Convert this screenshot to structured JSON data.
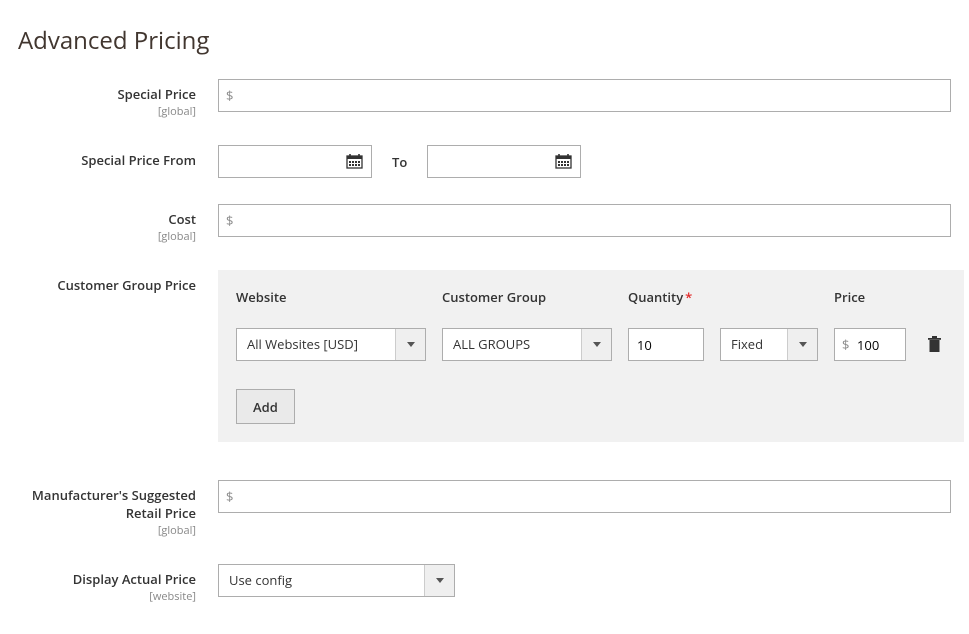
{
  "title": "Advanced Pricing",
  "scopes": {
    "global": "[global]",
    "website": "[website]"
  },
  "currency_symbol": "$",
  "specialPrice": {
    "label": "Special Price",
    "value": ""
  },
  "specialPriceFrom": {
    "label": "Special Price From",
    "from": "",
    "to_label": "To",
    "to": ""
  },
  "cost": {
    "label": "Cost",
    "value": ""
  },
  "groupPrice": {
    "label": "Customer Group Price",
    "headers": {
      "website": "Website",
      "group": "Customer Group",
      "qty": "Quantity",
      "price": "Price"
    },
    "row": {
      "website": "All Websites [USD]",
      "group": "ALL GROUPS",
      "qty": "10",
      "type": "Fixed",
      "price": "100"
    },
    "add_label": "Add"
  },
  "msrp": {
    "label": "Manufacturer's Suggested Retail Price",
    "value": ""
  },
  "displayActualPrice": {
    "label": "Display Actual Price",
    "value": "Use config"
  }
}
